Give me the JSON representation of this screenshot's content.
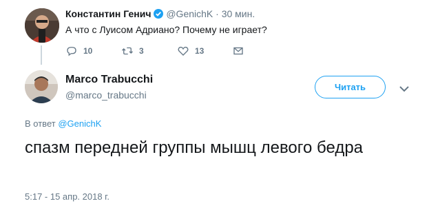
{
  "parent_tweet": {
    "name": "Константин Генич",
    "handle": "@GenichK",
    "separator": "·",
    "time": "30 мин.",
    "text": "А что с Луисом Адриано? Почему не играет?",
    "reply_count": "10",
    "retweet_count": "3",
    "like_count": "13"
  },
  "main_tweet": {
    "name": "Marco Trabucchi",
    "handle": "@marco_trabucchi",
    "follow_label": "Читать",
    "reply_prefix": "В ответ",
    "reply_mention": "@GenichK",
    "text": "спазм передней группы мышц левого бедра",
    "timestamp": "5:17 - 15 апр. 2018 г."
  },
  "colors": {
    "accent": "#1da1f2",
    "secondary_text": "#657786",
    "primary_text": "#14171a"
  },
  "icons": {
    "verified": "verified-badge-icon",
    "reply": "reply-icon",
    "retweet": "retweet-icon",
    "like": "heart-icon",
    "dm": "envelope-icon",
    "more": "chevron-down-icon"
  }
}
